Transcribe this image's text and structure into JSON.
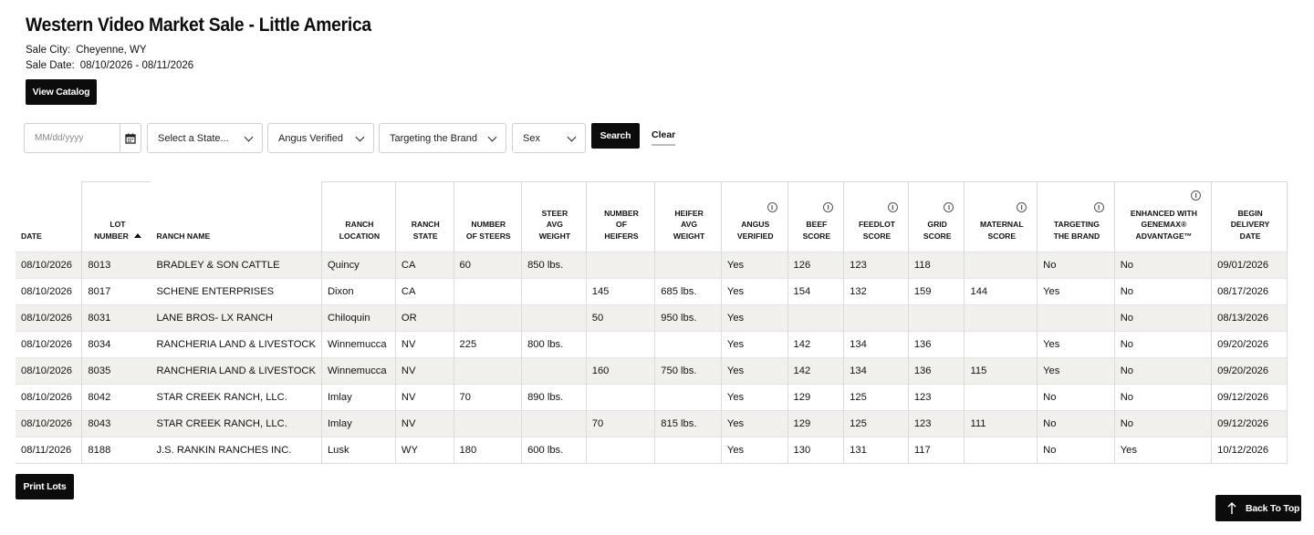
{
  "page": {
    "title": "Western Video Market Sale - Little America",
    "sale_city_label": "Sale City:",
    "sale_city": "Cheyenne, WY",
    "sale_date_label": "Sale Date:",
    "sale_date": "08/10/2026 - 08/11/2026",
    "view_catalog_label": "View Catalog"
  },
  "filters": {
    "date_placeholder": "MM/dd/yyyy",
    "state_select": "Select a State...",
    "angus_select": "Angus Verified",
    "brand_select": "Targeting the Brand",
    "sex_select": "Sex",
    "search_label": "Search",
    "clear_label": "Clear"
  },
  "table": {
    "headers": {
      "date": "Date",
      "lot_1": "Lot",
      "lot_2": "Number",
      "ranch_name": "Ranch Name",
      "location_1": "Ranch",
      "location_2": "Location",
      "state_1": "Ranch",
      "state_2": "State",
      "steers_1": "Number",
      "steers_2": "of Steers",
      "steer_wt_1": "Steer",
      "steer_wt_2": "Avg",
      "steer_wt_3": "Weight",
      "heifers_1": "Number",
      "heifers_2": "of",
      "heifers_3": "Heifers",
      "heifer_wt_1": "Heifer",
      "heifer_wt_2": "Avg",
      "heifer_wt_3": "Weight",
      "angus_1": "Angus",
      "angus_2": "Verified",
      "beef_1": "Beef",
      "beef_2": "Score",
      "feedlot_1": "Feedlot",
      "feedlot_2": "Score",
      "grid_1": "Grid",
      "grid_2": "Score",
      "maternal_1": "Maternal",
      "maternal_2": "Score",
      "targeting_1": "Targeting",
      "targeting_2": "the Brand",
      "genemax_1": "Enhanced with",
      "genemax_2": "GeneMax®",
      "genemax_3": "Advantage™",
      "delivery_1": "Begin",
      "delivery_2": "Delivery",
      "delivery_3": "Date",
      "info_glyph": "i"
    },
    "rows": [
      [
        "08/10/2026",
        "8013",
        "BRADLEY & SON CATTLE",
        "Quincy",
        "CA",
        "60",
        "850 lbs.",
        "",
        "",
        "Yes",
        "126",
        "123",
        "118",
        "",
        "No",
        "No",
        "09/01/2026"
      ],
      [
        "08/10/2026",
        "8017",
        "SCHENE ENTERPRISES",
        "Dixon",
        "CA",
        "",
        "",
        "145",
        "685 lbs.",
        "Yes",
        "154",
        "132",
        "159",
        "144",
        "Yes",
        "No",
        "08/17/2026"
      ],
      [
        "08/10/2026",
        "8031",
        "LANE BROS- LX RANCH",
        "Chiloquin",
        "OR",
        "",
        "",
        "50",
        "950 lbs.",
        "Yes",
        "",
        "",
        "",
        "",
        "",
        "No",
        "08/13/2026"
      ],
      [
        "08/10/2026",
        "8034",
        "RANCHERIA LAND & LIVESTOCK",
        "Winnemucca",
        "NV",
        "225",
        "800 lbs.",
        "",
        "",
        "Yes",
        "142",
        "134",
        "136",
        "",
        "Yes",
        "No",
        "09/20/2026"
      ],
      [
        "08/10/2026",
        "8035",
        "RANCHERIA LAND & LIVESTOCK",
        "Winnemucca",
        "NV",
        "",
        "",
        "160",
        "750 lbs.",
        "Yes",
        "142",
        "134",
        "136",
        "115",
        "Yes",
        "No",
        "09/20/2026"
      ],
      [
        "08/10/2026",
        "8042",
        "STAR CREEK RANCH, LLC.",
        "Imlay",
        "NV",
        "70",
        "890 lbs.",
        "",
        "",
        "Yes",
        "129",
        "125",
        "123",
        "",
        "No",
        "No",
        "09/12/2026"
      ],
      [
        "08/10/2026",
        "8043",
        "STAR CREEK RANCH, LLC.",
        "Imlay",
        "NV",
        "",
        "",
        "70",
        "815 lbs.",
        "Yes",
        "129",
        "125",
        "123",
        "111",
        "No",
        "No",
        "09/12/2026"
      ],
      [
        "08/11/2026",
        "8188",
        "J.S. RANKIN RANCHES INC.",
        "Lusk",
        "WY",
        "180",
        "600 lbs.",
        "",
        "",
        "Yes",
        "130",
        "131",
        "117",
        "",
        "No",
        "Yes",
        "10/12/2026"
      ]
    ]
  },
  "footer": {
    "print_label": "Print Lots",
    "back_to_top_label": "Back To Top"
  }
}
